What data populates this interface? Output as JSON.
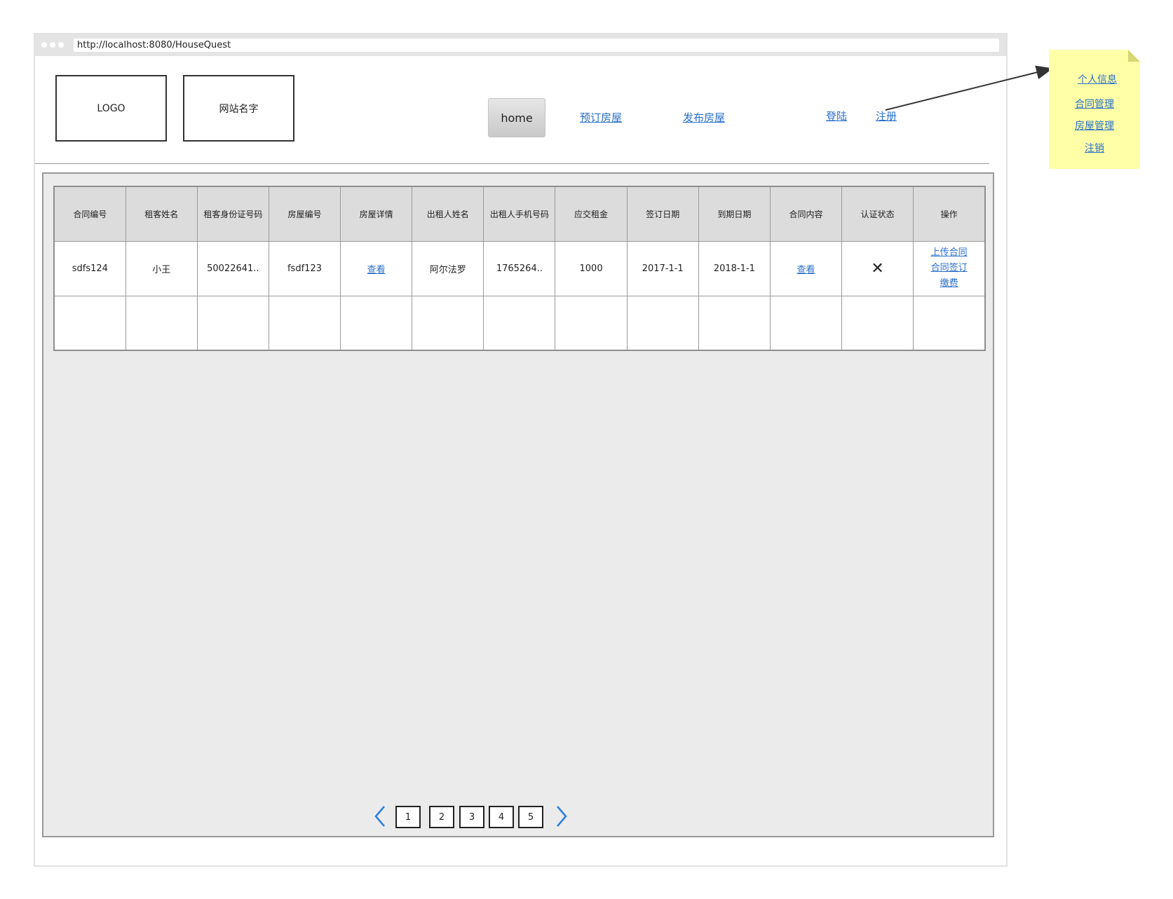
{
  "browser": {
    "url": "http://localhost:8080/HouseQuest"
  },
  "header": {
    "logo": "LOGO",
    "site_name": "网站名字",
    "home_label": "home",
    "nav": [
      "预订房屋",
      "发布房屋"
    ],
    "login_label": "登陆",
    "register_label": "注册"
  },
  "table": {
    "headers": [
      "合同编号",
      "租客姓名",
      "租客身份证号码",
      "房屋编号",
      "房屋详情",
      "出租人姓名",
      "出租人手机号码",
      "应交租金",
      "签订日期",
      "到期日期",
      "合同内容",
      "认证状态",
      "操作"
    ],
    "rows": [
      {
        "contract_no": "sdfs124",
        "tenant_name": "小王",
        "tenant_id": "50022641..",
        "house_no": "fsdf123",
        "house_detail": "查看",
        "landlord_name": "阿尔法罗",
        "landlord_phone": "1765264..",
        "rent": "1000",
        "sign_date": "2017-1-1",
        "expire_date": "2018-1-1",
        "contract_content": "查看",
        "status_icon": "✕",
        "actions": [
          "上传合同",
          "合同签订",
          "缴费"
        ]
      }
    ]
  },
  "pagination": {
    "pages": [
      "1",
      "2",
      "3",
      "4",
      "5"
    ]
  },
  "note": {
    "items": [
      "个人信息",
      "合同管理",
      "房屋管理",
      "注销"
    ]
  }
}
